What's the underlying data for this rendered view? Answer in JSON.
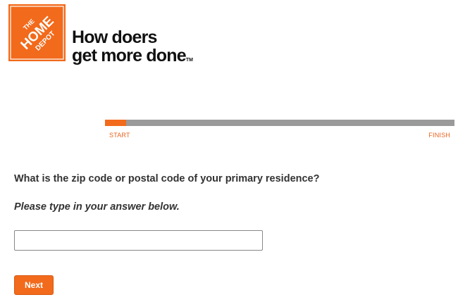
{
  "brand": {
    "logo_text": [
      "THE",
      "HOME",
      "DEPOT"
    ],
    "tagline_line1": "How doers",
    "tagline_line2": "get more done",
    "tagline_mark": "TM",
    "color": "#f26a1b"
  },
  "progress": {
    "start_label": "START",
    "finish_label": "FINISH",
    "fraction": 0.06
  },
  "question": {
    "text": "What is the zip code or postal code of your primary residence?",
    "instruction": "Please type in your answer below."
  },
  "answer": {
    "value": "",
    "placeholder": ""
  },
  "actions": {
    "next_label": "Next"
  }
}
